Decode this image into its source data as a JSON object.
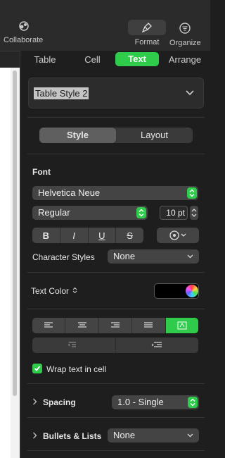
{
  "toolbar": {
    "collaborate_label": "Collaborate",
    "format_label": "Format",
    "organize_label": "Organize"
  },
  "tabs": [
    {
      "label": "Table",
      "active": false
    },
    {
      "label": "Cell",
      "active": false
    },
    {
      "label": "Text",
      "active": true
    },
    {
      "label": "Arrange",
      "active": false
    }
  ],
  "style_picker": {
    "name": "Table Style 2"
  },
  "segmented": {
    "style_label": "Style",
    "layout_label": "Layout"
  },
  "font": {
    "heading": "Font",
    "family": "Helvetica Neue",
    "typeface": "Regular",
    "size": "10 pt",
    "bold": "B",
    "italic": "I",
    "underline": "U",
    "strikethrough": "S"
  },
  "character_styles": {
    "label": "Character Styles",
    "value": "None"
  },
  "text_color": {
    "label": "Text Color",
    "color": "#000000"
  },
  "wrap": {
    "label": "Wrap text in cell",
    "checked": true
  },
  "spacing": {
    "label": "Spacing",
    "value": "1.0 - Single"
  },
  "bullets": {
    "label": "Bullets & Lists",
    "value": "None"
  },
  "colors": {
    "accent": "#2fcb4b",
    "panel": "#1e1e1e",
    "control": "#444444"
  }
}
